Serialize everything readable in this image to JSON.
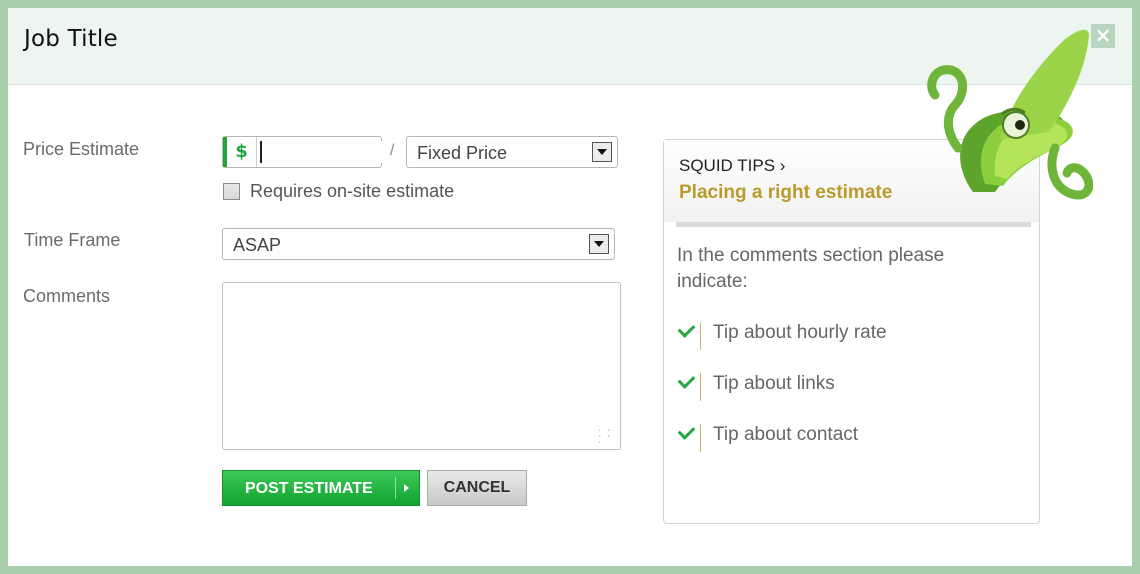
{
  "dialog": {
    "title": "Job Title",
    "close_label": "×"
  },
  "form": {
    "price_label": "Price Estimate",
    "currency_symbol": "$",
    "price_value": "",
    "slash": "/",
    "pricing_type": "Fixed Price",
    "onsite_label": "Requires on-site estimate",
    "onsite_checked": false,
    "timeframe_label": "Time Frame",
    "timeframe_value": "ASAP",
    "comments_label": "Comments",
    "comments_value": ""
  },
  "buttons": {
    "post": "POST ESTIMATE",
    "cancel": "CANCEL"
  },
  "tips": {
    "title": "SQUID TIPS ›",
    "subtitle": "Placing a right estimate",
    "intro": "In the comments section please indicate:",
    "items": [
      {
        "label": "Tip about hourly rate"
      },
      {
        "label": "Tip about links"
      },
      {
        "label": "Tip about contact"
      }
    ]
  },
  "colors": {
    "accent_green": "#21a83d",
    "tips_gold": "#b89b2b",
    "frame_green": "#a9cfab",
    "header_bg": "#ecf5ef"
  },
  "icons": [
    "close-icon",
    "dollar-icon",
    "chevron-down-icon",
    "check-icon",
    "play-arrow-icon",
    "squid-mascot"
  ]
}
